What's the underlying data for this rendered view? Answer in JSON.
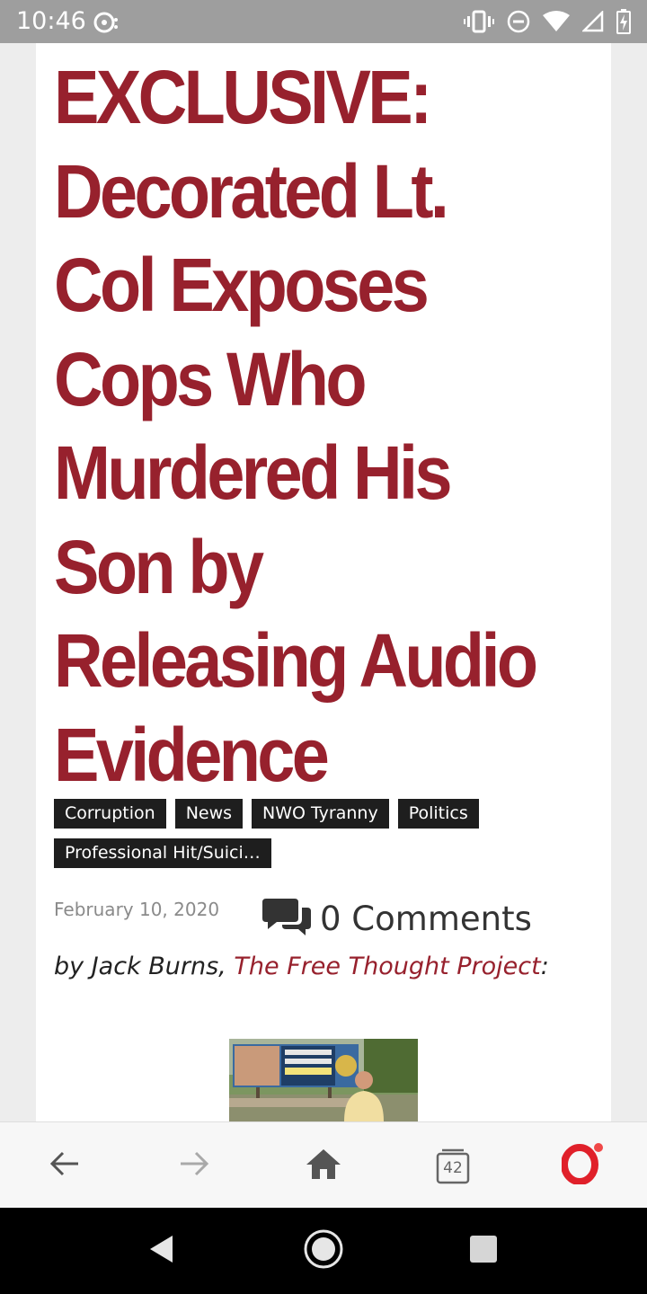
{
  "status_bar": {
    "time": "10:46",
    "icons": [
      "notification-icon",
      "vibrate-icon",
      "do-not-disturb-icon",
      "wifi-icon",
      "cell-signal-icon",
      "battery-charging-icon"
    ]
  },
  "article": {
    "headline": "EXCLUSIVE: Decorated Lt. Col Exposes Cops Who Murdered His Son by Releasing Audio Evidence",
    "tags": [
      "Corruption",
      "News",
      "NWO Tyranny",
      "Politics",
      "Professional Hit/Suici…"
    ],
    "date": "February 10, 2020",
    "comments_label": "0 Comments",
    "byline_prefix": "by Jack Burns, ",
    "byline_source": "The Free Thought Project",
    "byline_suffix": ":"
  },
  "browser_nav": {
    "tab_count": "42",
    "icons": [
      "back-arrow-icon",
      "forward-arrow-icon",
      "home-icon",
      "tabs-icon",
      "opera-menu-icon"
    ]
  },
  "colors": {
    "headline": "#97212d",
    "tag_background": "#1e1e1e",
    "status_bar": "#9e9e9e",
    "opera_red": "#e0202a"
  }
}
